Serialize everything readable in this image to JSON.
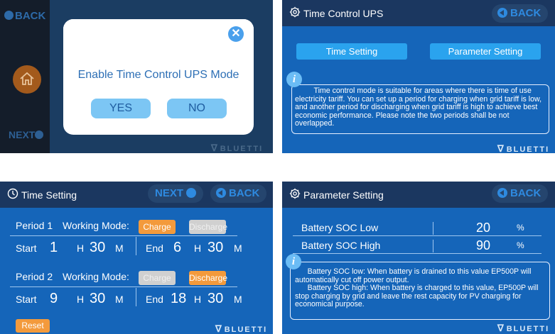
{
  "brand": "BLUETTI",
  "panel1": {
    "side_back": "BACK",
    "side_next": "NEXT",
    "dialog_message": "Enable Time Control UPS Mode",
    "yes_label": "YES",
    "no_label": "NO",
    "close_icon": "close-icon"
  },
  "panel2": {
    "title": "Time Control UPS",
    "back_label": "BACK",
    "tab_time": "Time Setting",
    "tab_param": "Parameter Setting",
    "info_icon": "i",
    "info_text": "Time control mode is suitable for areas where there is time of use electricity tariff. You can set up a period for charging when grid tariff is low, and another period for discharging when grid tariff is high to achieve best economic performance. Please note the two periods shall be not overlapped."
  },
  "panel3": {
    "title": "Time Setting",
    "next_label": "NEXT",
    "back_label": "BACK",
    "working_mode_label": "Working Mode:",
    "charge_label": "Charge",
    "discharge_label": "Discharge",
    "start_label": "Start",
    "end_label": "End",
    "h_label": "H",
    "m_label": "M",
    "periods": [
      {
        "label": "Period 1",
        "active_mode": "Charge",
        "start_h": "1",
        "start_m": "30",
        "end_h": "6",
        "end_m": "30"
      },
      {
        "label": "Period 2",
        "active_mode": "Discharge",
        "start_h": "9",
        "start_m": "30",
        "end_h": "18",
        "end_m": "30"
      }
    ],
    "reset_label": "Reset"
  },
  "panel4": {
    "title": "Parameter Setting",
    "back_label": "BACK",
    "rows": [
      {
        "label": "Battery SOC Low",
        "value": "20",
        "unit": "%"
      },
      {
        "label": "Battery SOC High",
        "value": "90",
        "unit": "%"
      }
    ],
    "info_icon": "i",
    "info_text_1": "Battery SOC low:  When battery is drained to this value EP500P will automatically cut off power output.",
    "info_text_2": "Battery SOC high:  When battery is charged to this value, EP500P will stop charging by grid and leave the rest capacity for PV charging for economical purpose."
  },
  "colors": {
    "panel_blue": "#1565b9",
    "header_navy": "#1b3760",
    "accent_orange": "#f39a3c",
    "button_light_blue": "#2aa3ee",
    "back_blue": "#2e8ae0"
  }
}
